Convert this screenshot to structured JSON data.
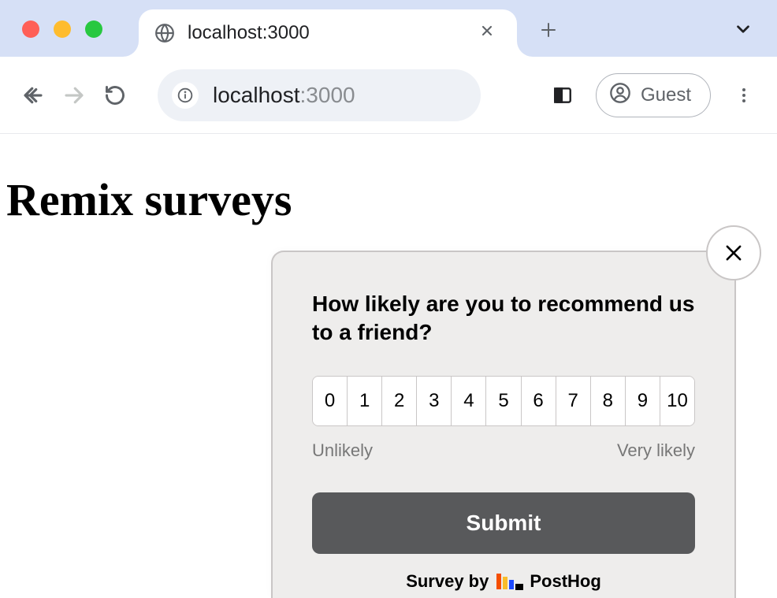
{
  "browser": {
    "tab_title": "localhost:3000",
    "url_host": "localhost",
    "url_port": ":3000",
    "profile_label": "Guest"
  },
  "page": {
    "title": "Remix surveys"
  },
  "survey": {
    "question": "How likely are you to recommend us to a friend?",
    "scale": [
      "0",
      "1",
      "2",
      "3",
      "4",
      "5",
      "6",
      "7",
      "8",
      "9",
      "10"
    ],
    "low_label": "Unlikely",
    "high_label": "Very likely",
    "submit_label": "Submit",
    "footer_prefix": "Survey by",
    "footer_brand": "PostHog"
  }
}
